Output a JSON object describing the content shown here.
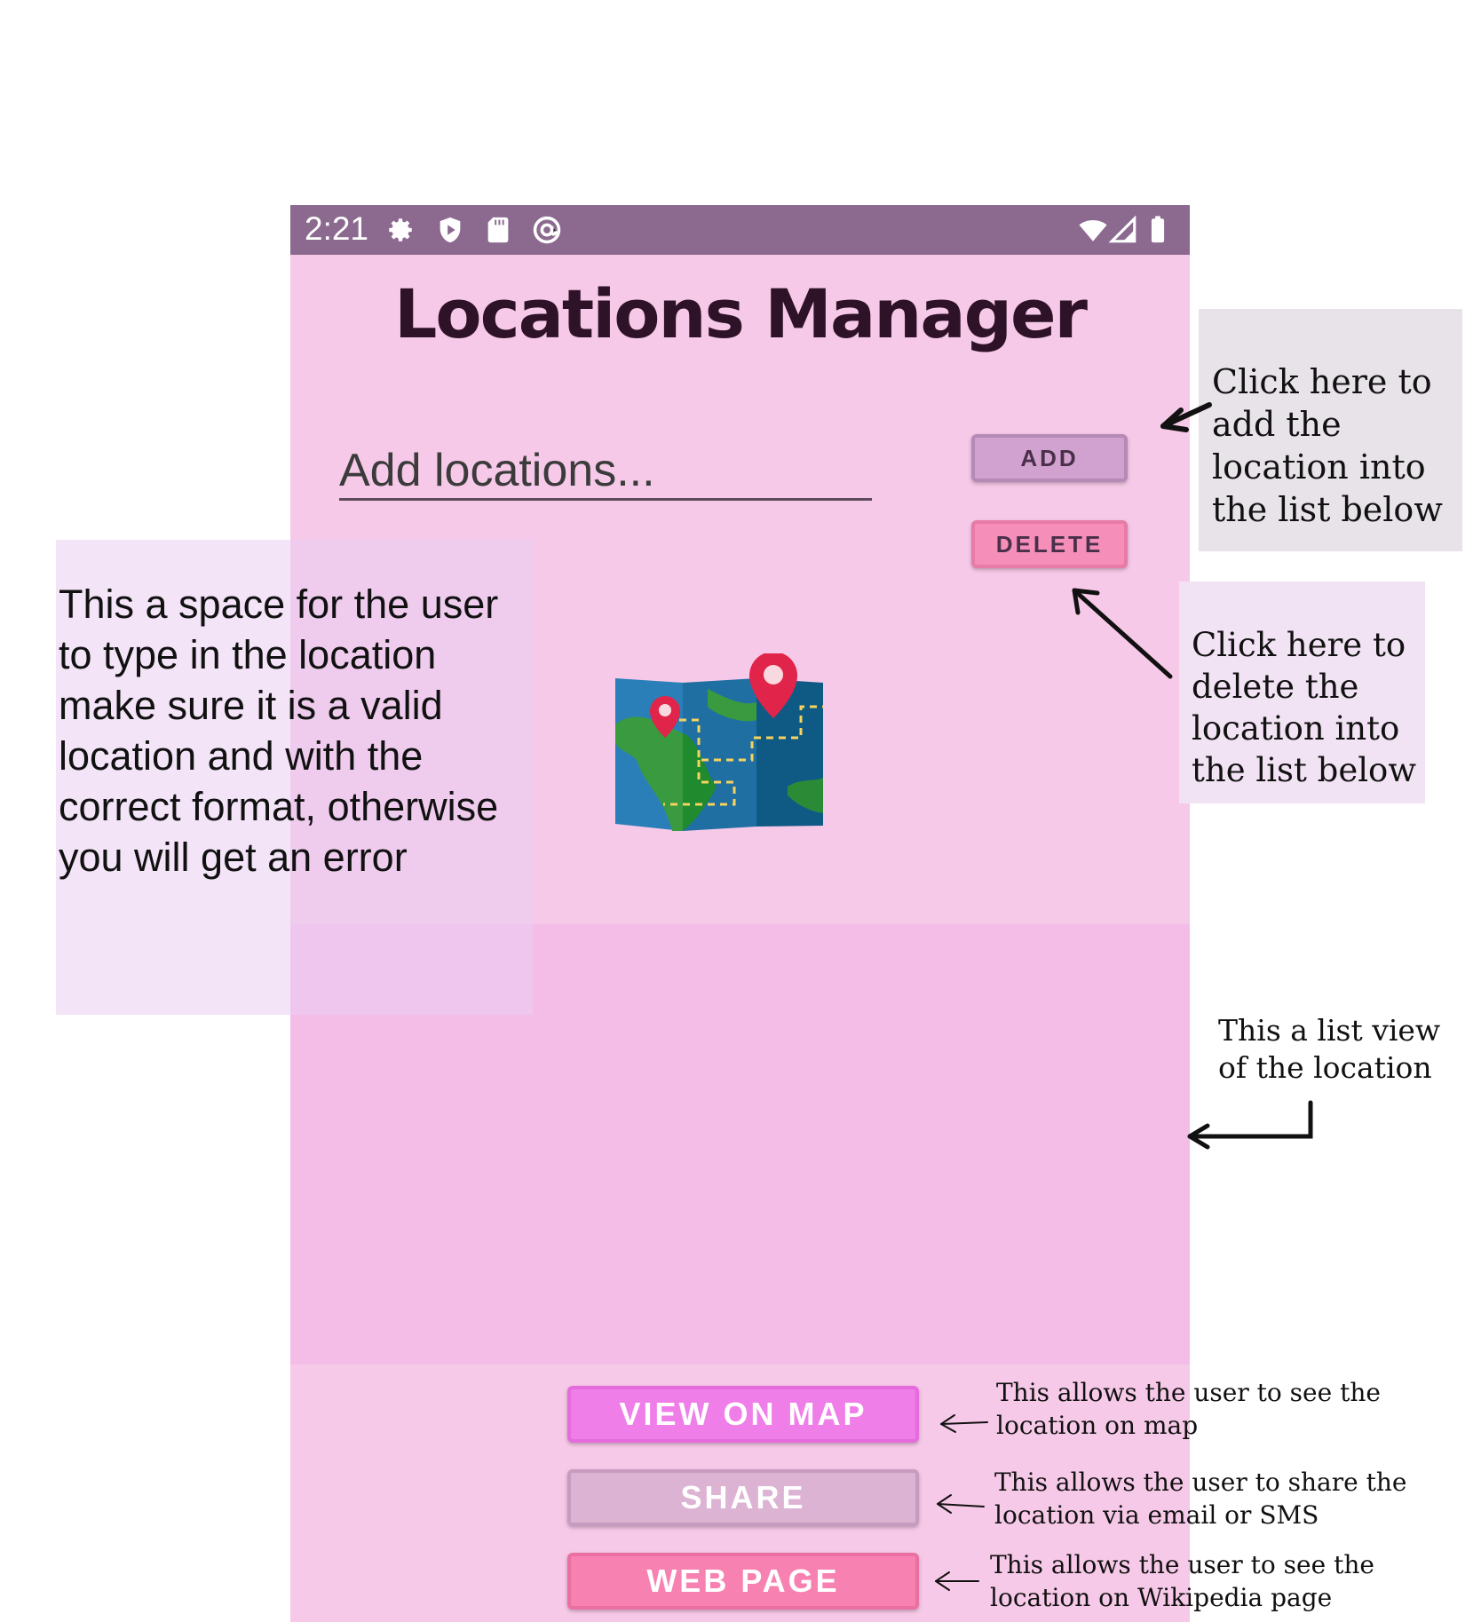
{
  "status_bar": {
    "time": "2:21",
    "left_icons": [
      "gear-icon",
      "shield-icon",
      "sd-card-icon",
      "at-sign-icon"
    ],
    "right_icons": [
      "wifi-icon",
      "signal-icon",
      "battery-icon"
    ]
  },
  "app": {
    "title": "Locations Manager",
    "input_placeholder": "Add locations...",
    "add_label": "ADD",
    "delete_label": "DELETE",
    "list_items": [],
    "view_on_map_label": "VIEW ON MAP",
    "share_label": "SHARE",
    "web_page_label": "WEB PAGE"
  },
  "annotations": {
    "input_note": "This a space for the user to type in the location make sure it is a valid location and with the correct format, otherwise you will get an error",
    "add_note": "Click here to add the location into the list below",
    "delete_note": "Click here to delete the location into the list below",
    "list_note": "This a list view of the location",
    "map_note": "This allows the user to see the location on map",
    "share_note": "This allows the user to share the location via email or SMS",
    "web_note": "This allows the user to see the location on Wikipedia page"
  },
  "colors": {
    "status_bar": "#8c6a90",
    "background": "#f7c9e8",
    "list_view": "#f4bde8",
    "add_button": "#d1a2cf",
    "delete_button": "#f58fba",
    "view_on_map_button": "#f07ee8",
    "share_button": "#ddb3d4",
    "web_page_button": "#f782b2"
  }
}
